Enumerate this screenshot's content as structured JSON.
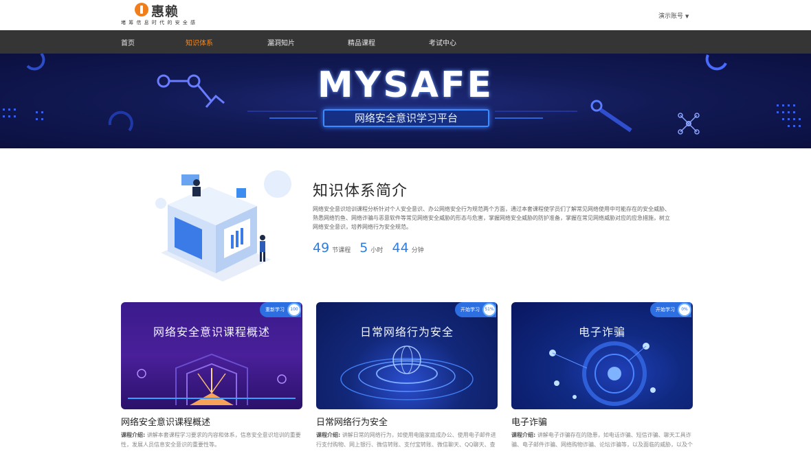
{
  "header": {
    "logo_name": "惠赖",
    "logo_slogan": "堵 筹 信 息 时 代 的 安 全 感",
    "account_label": "演示账号"
  },
  "nav": {
    "items": [
      {
        "label": "首页",
        "active": false
      },
      {
        "label": "知识体系",
        "active": true
      },
      {
        "label": "漏洞知片",
        "active": false
      },
      {
        "label": "精品课程",
        "active": false
      },
      {
        "label": "考试中心",
        "active": false
      }
    ]
  },
  "banner": {
    "title": "MYSAFE",
    "subtitle": "网络安全意识学习平台"
  },
  "intro": {
    "heading": "知识体系简介",
    "text": "网络安全意识培训课程分析针对个人安全意识、办公网络安全行为规范两个方面，通过本套课程使学员们了解常见网络使用中可能存在的安全威胁、熟悉网络钓鱼、网络诈骗与恶意软件等常见网络安全威胁的形态与危害，掌握网络安全威胁的防护准备，掌握在常见网络威胁对应的应急措施，树立网络安全意识，培养网络行为安全规范。",
    "stats": [
      {
        "value": "49",
        "unit": "节课程"
      },
      {
        "value": "5",
        "unit": "小时"
      },
      {
        "value": "44",
        "unit": "分钟"
      }
    ]
  },
  "courses": [
    {
      "image_text": "网络安全意识课程概述",
      "badge_label": "重新学习",
      "badge_pct": "100",
      "title": "网络安全意识课程概述",
      "desc_label": "课程介绍:",
      "desc": "讲解本套课程学习要求的内容和体系，信息安全意识培训的重要性，发展人员信息安全意识的重要性等。",
      "theme": "#3a1a7a"
    },
    {
      "image_text": "日常网络行为安全",
      "badge_label": "开始学习",
      "badge_pct": "51%",
      "title": "日常网络行为安全",
      "desc_label": "课程介绍:",
      "desc": "讲解日常的网络行为，如使用电脑家庭成办公、使用电子邮件进行支付购物、网上银行、微信转账、支付宝转账、微信聊天、QQ聊天、查看社交软件等，以及在日常网络行为中的安全风险。",
      "theme": "#0f2470"
    },
    {
      "image_text": "电子诈骗",
      "badge_label": "开始学习",
      "badge_pct": "0%",
      "title": "电子诈骗",
      "desc_label": "课程介绍:",
      "desc": "讲解电子诈骗存在的隐患，如电话诈骗、短信诈骗、聊天工具诈骗、电子邮件诈骗、网络购物诈骗、论坛诈骗等，以及面临的威胁，以及个人信息泄露产生的危害，影响企业安全等。",
      "theme": "#0c1a66"
    }
  ]
}
